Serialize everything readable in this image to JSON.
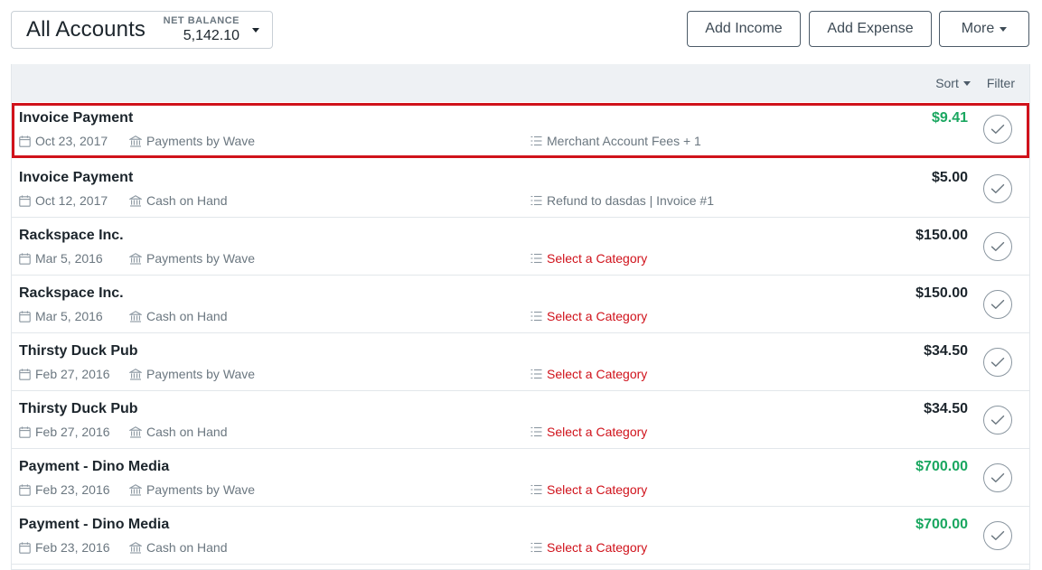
{
  "header": {
    "account_name": "All Accounts",
    "net_balance_label": "NET BALANCE",
    "net_balance_value": "5,142.10",
    "add_income_label": "Add Income",
    "add_expense_label": "Add Expense",
    "more_label": "More"
  },
  "toolbar": {
    "sort_label": "Sort",
    "filter_label": "Filter"
  },
  "transactions": [
    {
      "title": "Invoice Payment",
      "date": "Oct 23, 2017",
      "account": "Payments by Wave",
      "category": "Merchant Account Fees + 1",
      "amount": "$9.41"
    },
    {
      "title": "Invoice Payment",
      "date": "Oct 12, 2017",
      "account": "Cash on Hand",
      "category": "Refund to dasdas | Invoice #1",
      "amount": "$5.00"
    },
    {
      "title": "Rackspace Inc.",
      "date": "Mar 5, 2016",
      "account": "Payments by Wave",
      "category": "Select a Category",
      "amount": "$150.00"
    },
    {
      "title": "Rackspace Inc.",
      "date": "Mar 5, 2016",
      "account": "Cash on Hand",
      "category": "Select a Category",
      "amount": "$150.00"
    },
    {
      "title": "Thirsty Duck Pub",
      "date": "Feb 27, 2016",
      "account": "Payments by Wave",
      "category": "Select a Category",
      "amount": "$34.50"
    },
    {
      "title": "Thirsty Duck Pub",
      "date": "Feb 27, 2016",
      "account": "Cash on Hand",
      "category": "Select a Category",
      "amount": "$34.50"
    },
    {
      "title": "Payment - Dino Media",
      "date": "Feb 23, 2016",
      "account": "Payments by Wave",
      "category": "Select a Category",
      "amount": "$700.00"
    },
    {
      "title": "Payment - Dino Media",
      "date": "Feb 23, 2016",
      "account": "Cash on Hand",
      "category": "Select a Category",
      "amount": "$700.00"
    }
  ],
  "icons": {
    "date": "calendar-icon",
    "account": "bank-icon",
    "category": "list-icon",
    "status": "check-circle-icon",
    "dropdown": "caret-down-icon"
  },
  "colors": {
    "income": "#1aa760",
    "uncategorized": "#d0121b",
    "selection_outline": "#d0121b"
  }
}
